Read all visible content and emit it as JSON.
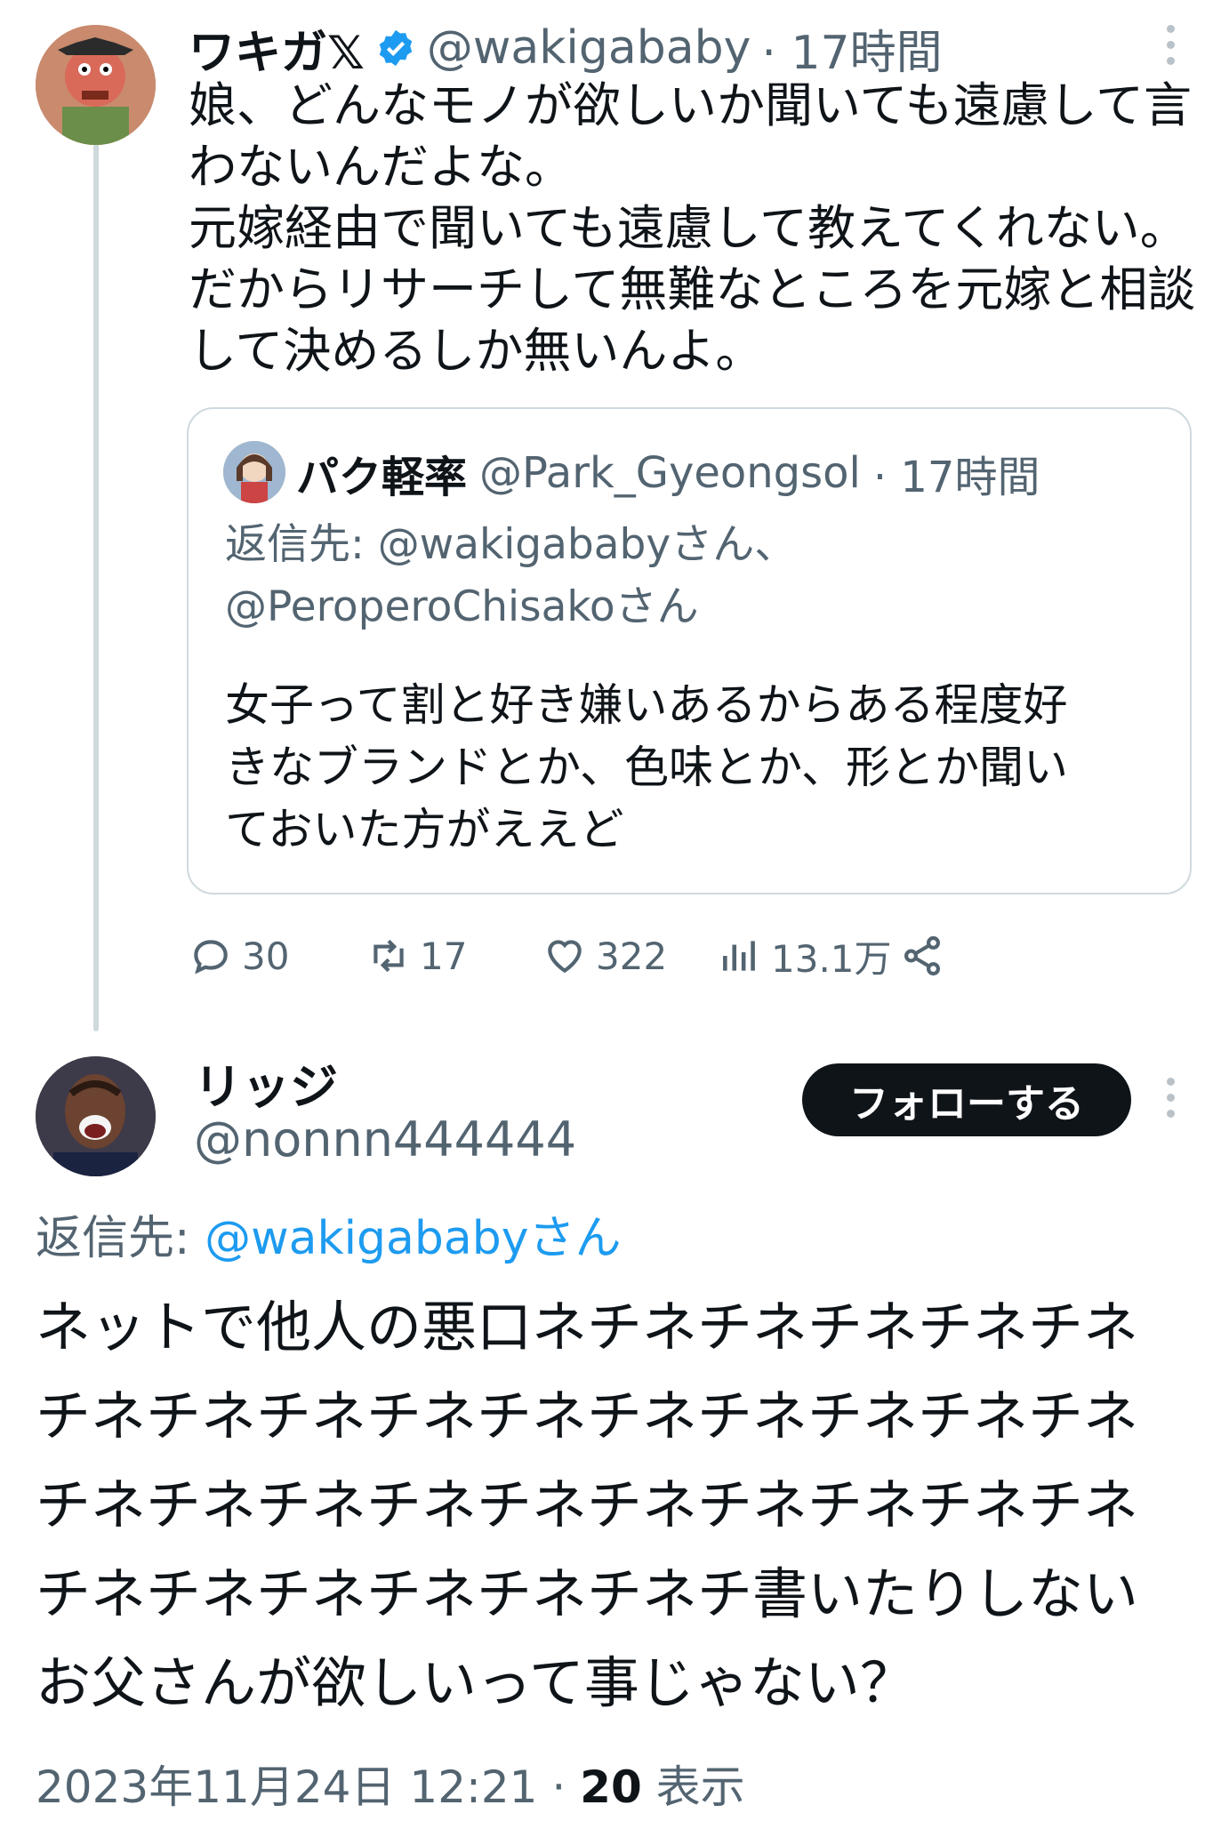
{
  "colors": {
    "text": "#0f1419",
    "secondary": "#536471",
    "link": "#1d9bf0",
    "border": "#cfd9de",
    "verified": "#1d9bf0"
  },
  "tweet1": {
    "name": "ワキガ𝕏",
    "handle": "@wakigababy",
    "time": "· 17時間",
    "body": "娘、どんなモノが欲しいか聞いても遠慮して言\nわないんだよな。\n元嫁経由で聞いても遠慮して教えてくれない。\nだからリサーチして無難なところを元嫁と相談\nして決めるしか無いんよ。",
    "quote": {
      "name": "パク軽率",
      "handle": "@Park_Gyeongsol",
      "time": "· 17時間",
      "reply_to_line1": "返信先: @wakigababyさん、",
      "reply_to_line2": "@PeroperoChisakoさん",
      "body": "女子って割と好き嫌いあるからある程度好\nきなブランドとか、色味とか、形とか聞い\nておいた方がええど"
    },
    "actions": {
      "replies": "30",
      "retweets": "17",
      "likes": "322",
      "views": "13.1万"
    }
  },
  "tweet2": {
    "name": "リッジ",
    "handle": "@nonnn444444",
    "follow_label": "フォローする",
    "reply_prefix": "返信先: ",
    "reply_mention": "@wakigababyさん",
    "body": "ネットで他人の悪口ネチネチネチネチネチネ\nチネチネチネチネチネチネチネチネチネチネ\nチネチネチネチネチネチネチネチネチネチネ\nチネチネチネチネチネチネチ書いたりしない\nお父さんが欲しいって事じゃない？",
    "date": "2023年11月24日 12:21 · ",
    "views_count": "20",
    "views_label": " 表示"
  }
}
